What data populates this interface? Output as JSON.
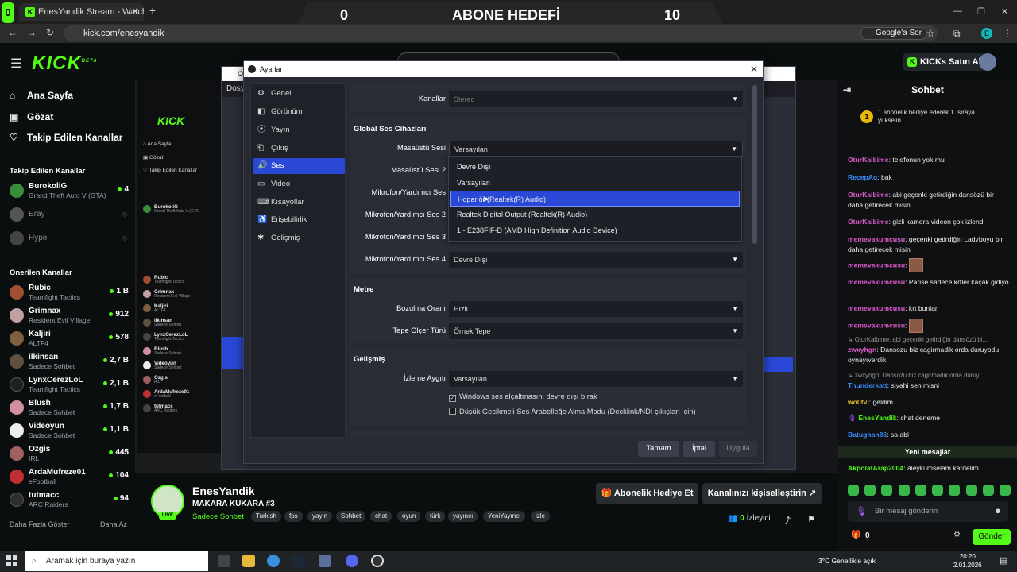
{
  "browser": {
    "tab_title": "EnesYandik Stream - Watch Live",
    "url": "kick.com/enesyandik",
    "google_ask": "Google'a Sor",
    "profile_initial": "E"
  },
  "overlay": {
    "left_value": "0",
    "title": "ABONE HEDEFİ",
    "right_value": "10"
  },
  "kick": {
    "logo": "KICK",
    "beta": "BETA",
    "buy_kicks": "KICKs Satın Al",
    "nav": [
      {
        "label": "Ana Sayfa",
        "icon": "home-icon"
      },
      {
        "label": "Gözat",
        "icon": "browse-icon"
      },
      {
        "label": "Takip Edilen Kanallar",
        "icon": "heart-icon"
      }
    ],
    "followed_title": "Takip Edilen Kanallar",
    "followed": [
      {
        "name": "BurokoliG",
        "game": "Grand Theft Auto V (GTA)",
        "viewers": "4",
        "color": "#3a8d3a",
        "offline": false
      },
      {
        "name": "Eray",
        "game": "",
        "viewers": "",
        "color": "#555",
        "offline": true
      },
      {
        "name": "Hype",
        "game": "",
        "viewers": "",
        "color": "#444",
        "offline": true
      }
    ],
    "recommended_title": "Önerilen Kanallar",
    "recommended": [
      {
        "name": "Rubic",
        "game": "Teamfight Tactics",
        "viewers": "1 B",
        "color": "#a05030"
      },
      {
        "name": "Grimnax",
        "game": "Resident Evil Village",
        "viewers": "912",
        "color": "#c0a0a0"
      },
      {
        "name": "Kaljiri",
        "game": "ALTF4",
        "viewers": "578",
        "color": "#806040"
      },
      {
        "name": "ilkinsan",
        "game": "Sadece Sohbet",
        "viewers": "2,7 B",
        "color": "#605040"
      },
      {
        "name": "LynxCerezLoL",
        "game": "Teamfight Tactics",
        "viewers": "2,1 B",
        "color": "#202020"
      },
      {
        "name": "Blush",
        "game": "Sadece Sohbet",
        "viewers": "1,7 B",
        "color": "#d090a0"
      },
      {
        "name": "Videoyun",
        "game": "Sadece Sohbet",
        "viewers": "1,1 B",
        "color": "#eee"
      },
      {
        "name": "Ozgis",
        "game": "IRL",
        "viewers": "445",
        "color": "#a06060"
      },
      {
        "name": "ArdaMufreze01",
        "game": "eFootball",
        "viewers": "104",
        "color": "#c03030"
      },
      {
        "name": "tutmacc",
        "game": "ARC Raiders",
        "viewers": "94",
        "color": "#303030"
      }
    ],
    "show_more": "Daha Fazla Göster",
    "show_less": "Daha Az"
  },
  "obs_back": {
    "title": "OB",
    "menu": "Dosya"
  },
  "settings": {
    "title": "Ayarlar",
    "nav": [
      {
        "label": "Genel",
        "icon": "gear-icon"
      },
      {
        "label": "Görünüm",
        "icon": "appearance-icon"
      },
      {
        "label": "Yayın",
        "icon": "stream-icon"
      },
      {
        "label": "Çıkış",
        "icon": "output-icon"
      },
      {
        "label": "Ses",
        "icon": "audio-icon"
      },
      {
        "label": "Video",
        "icon": "video-icon"
      },
      {
        "label": "Kısayollar",
        "icon": "hotkeys-icon"
      },
      {
        "label": "Erişebilirlik",
        "icon": "accessibility-icon"
      },
      {
        "label": "Gelişmiş",
        "icon": "advanced-icon"
      }
    ],
    "selected_nav": "Ses",
    "channels_label": "Kanallar",
    "channels_value": "Stereo",
    "global_title": "Global Ses Cihazları",
    "desktop_label": "Masaüstü Sesi",
    "desktop_value": "Varsayılan",
    "desktop2_label": "Masaüstü Sesi 2",
    "mic_label": "Mikrofon/Yardımcı Ses",
    "mic2_label": "Mikrofon/Yardımcı Ses 2",
    "mic3_label": "Mikrofon/Yardımcı Ses 3",
    "mic4_label": "Mikrofon/Yardımcı Ses 4",
    "mic4_value": "Devre Dışı",
    "dropdown": [
      "Devre Dışı",
      "Varsayılan",
      "Hoparlör (Realtek(R) Audio)",
      "Realtek Digital Output (Realtek(R) Audio)",
      "1 - E238FIF-D (AMD High Definition Audio Device)"
    ],
    "dropdown_highlight": "Hoparlör (Realtek(R) Audio)",
    "meters_title": "Metre",
    "decay_label": "Bozulma Oranı",
    "decay_value": "Hızlı",
    "peak_label": "Tepe Ölçer Türü",
    "peak_value": "Örnek Tepe",
    "advanced_title": "Gelişmiş",
    "monitor_label": "İzleme Aygıtı",
    "monitor_value": "Varsayılan",
    "check1": "Windows ses alçaltmasını devre dışı bırak",
    "check2": "Düşük Gecikmeli Ses Arabelleğe Alma Modu (Decklink/NDI çıkışları için)",
    "check1_checked": true,
    "check2_checked": false,
    "ok": "Tamam",
    "cancel": "İptal",
    "apply": "Uygula"
  },
  "chat": {
    "title": "Sohbet",
    "pinned": "1 abonelik hediye ederek 1. sıraya yükselin",
    "pinned_rank": "1",
    "messages": [
      {
        "user": "OturKalbime",
        "text": "telefonun yok mu",
        "color": "#e05bd0"
      },
      {
        "user": "RecepAq",
        "text": "bak",
        "color": "#3c8dff"
      },
      {
        "user": "OturKalbime",
        "text": "abi geçenki getirdiğin dansözü bir daha getirecek misin",
        "color": "#e05bd0"
      },
      {
        "user": "OturKalbime",
        "text": "gizli kamera videon çok izlendi",
        "color": "#e05bd0"
      },
      {
        "user": "memevakumcusu",
        "text": "geçenki getirdiğin Ladyboyu bir daha getirecek misin",
        "color": "#e05bd0"
      },
      {
        "user": "memevakumcusu",
        "text": "",
        "color": "#e05bd0"
      },
      {
        "user": "memevakumcusu",
        "text": "Parise sadece krtler kaçak gidiyo",
        "color": "#e05bd0"
      },
      {
        "user": "memevakumcusu",
        "text": "krt bunlar",
        "color": "#e05bd0"
      },
      {
        "user": "memevakumcusu",
        "text": "",
        "color": "#e05bd0"
      },
      {
        "user": "",
        "text": "OturKalbime: abi geçenki getirdiğin dansözü bi...",
        "color": "#999"
      },
      {
        "user": "zwxyhgn",
        "text": "Dansozu biz cagirmadik orda duruyodu oynayıverdik",
        "color": "#e05bd0"
      },
      {
        "user": "",
        "text": "zwxyhgn: Dansozu biz cagirmadik orda duruy...",
        "color": "#999"
      },
      {
        "user": "Thunderkatt",
        "text": "siyahi sen misni",
        "color": "#3c8dff"
      },
      {
        "user": "wo0fvl",
        "text": "geldim",
        "color": "#e0c020"
      },
      {
        "user": "EnesYandik",
        "text": "chat deneme",
        "color": "#53fc18"
      },
      {
        "user": "Batughan86",
        "text": "sa abi",
        "color": "#3c8dff"
      }
    ],
    "new_messages": "Yeni mesajlar",
    "last_user": "AkpolatArap2004",
    "last_text": "aleykümselam kardelim",
    "input_placeholder": "Bir mesaj gönderin",
    "kicks_count": "0",
    "send": "Gönder"
  },
  "streamer": {
    "name": "EnesYandik",
    "title": "MAKARA KUKARA #3",
    "category": "Sadece Sohbet",
    "tags": [
      "Turkish",
      "fps",
      "yayın",
      "Sohbet",
      "chat",
      "oyun",
      "türk",
      "yayıncı",
      "YeniYayıncı",
      "izle"
    ],
    "live": "LİVE",
    "gift": "Abonelik Hediye Et",
    "customize": "Kanalınızı kişiselleştirin",
    "viewer_count": "0",
    "viewer_label": "İzleyici"
  },
  "taskbar": {
    "search": "Aramak için buraya yazın",
    "weather": "3°C Genellikle açık",
    "time": "20:20",
    "date": "2.01.2026"
  }
}
